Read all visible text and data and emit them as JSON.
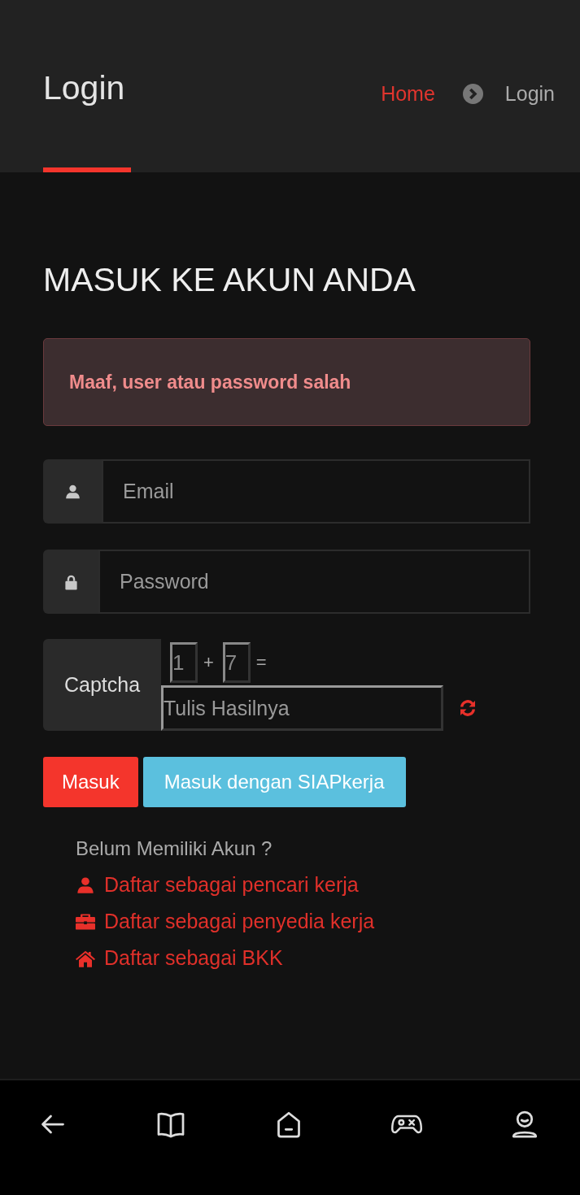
{
  "header": {
    "title": "Login",
    "breadcrumb": [
      {
        "label": "Home",
        "current": false
      },
      {
        "label": "Login",
        "current": true
      }
    ]
  },
  "heading": "MASUK KE AKUN ANDA",
  "alert": {
    "kind": "danger",
    "text": "Maaf, user atau password salah"
  },
  "fields": [
    {
      "kind": "user",
      "placeholder": "Email"
    },
    {
      "kind": "lock",
      "placeholder": "Password"
    }
  ],
  "captcha": {
    "label": "Captcha",
    "first": "1",
    "operator": "+",
    "second": "7",
    "equals": "=",
    "placeholder": "Tulis Hasilnya"
  },
  "buttons": [
    {
      "kind": "primary",
      "label": "Masuk"
    },
    {
      "kind": "info",
      "label": "Masuk dengan SIAPkerja"
    }
  ],
  "register": {
    "prompt": "Belum Memiliki Akun ?",
    "links": [
      {
        "kind": "user",
        "label": "Daftar sebagai pencari kerja"
      },
      {
        "kind": "briefcase",
        "label": "Daftar sebagai penyedia kerja"
      },
      {
        "kind": "home",
        "label": "Daftar sebagai BKK"
      }
    ]
  },
  "nav": [
    {
      "kind": "back"
    },
    {
      "kind": "book"
    },
    {
      "kind": "home"
    },
    {
      "kind": "game"
    },
    {
      "kind": "profile"
    }
  ]
}
